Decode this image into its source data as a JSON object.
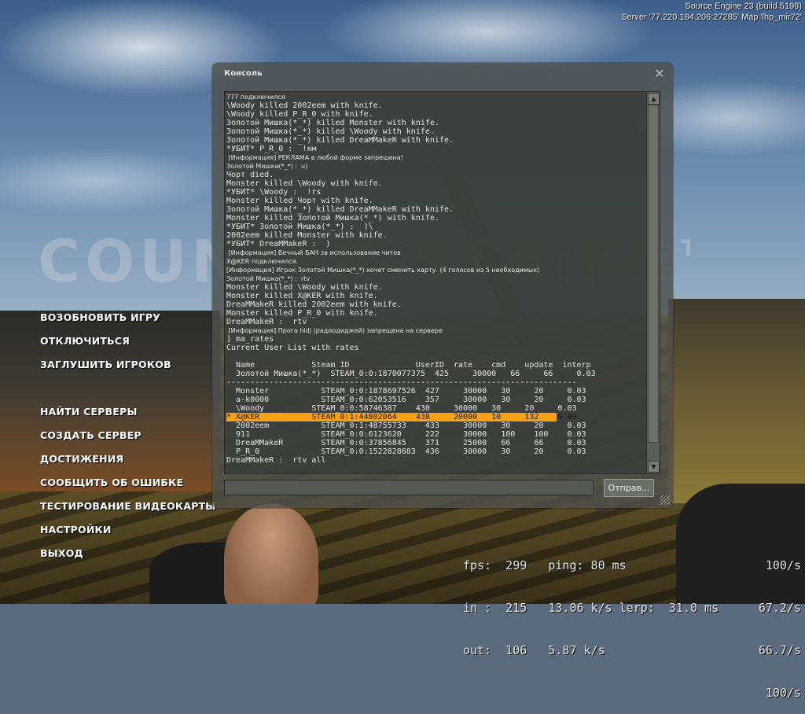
{
  "version": {
    "engine": "Source Engine 23 (build 5198)",
    "server": "Server '77.220.184.206:27285' Map 'lhp_mir72'"
  },
  "watermark": "COUNTER-STRIKE™",
  "menu": {
    "resume": "ВОЗОБНОВИТЬ ИГРУ",
    "disconnect": "ОТКЛЮЧИТЬСЯ",
    "mute": "ЗАГЛУШИТЬ ИГРОКОВ",
    "find": "НАЙТИ СЕРВЕРЫ",
    "create": "СОЗДАТЬ СЕРВЕР",
    "achievements": "ДОСТИЖЕНИЯ",
    "report": "СООБЩИТЬ ОБ ОШИБКЕ",
    "stress": "ТЕСТИРОВАНИЕ ВИДЕОКАРТЫ",
    "options": "НАСТРОЙКИ",
    "quit": "ВЫХОД"
  },
  "console": {
    "title": "Консоль",
    "close_glyph": "✕",
    "submit_label": "Отправ...",
    "input_value": "",
    "lines": [
      "777 подключился.",
      "\\Woody killed 2002eem with knife.",
      "\\Woody killed P_R_0 with knife.",
      "Золотой Мишка(*_*) killed Monster with knife.",
      "Золотой Мишка(*_*) killed \\Woody with knife.",
      "Золотой Мишка(*_*) killed DreaMMakeR with knife.",
      "*УБИТ* P_R_0 :  !км",
      " [Информация] РЕКЛАМА в любой форме запрещена!",
      "Золотой Мишка(*_*) :  u)",
      "Чорт died.",
      "Monster killed \\Woody with knife.",
      "*УБИТ* \\Woody :  !rs",
      "Monster killed Чорт with knife.",
      "Золотой Мишка(*_*) killed DreaMMakeR with knife.",
      "Monster killed Золотой Мишка(*_*) with knife.",
      "*УБИТ* Золотой Мишка(*_*) :  )\\",
      "2002eem killed Monster with knife.",
      "*УБИТ* DreaMMakeR :  )",
      " [Информация] Вечный БАН за использование читов",
      "X@KER подключился.",
      "[Информация] Игрок Золотой Мишка(*_*) хочет сменить карту. (4 голосов из 5 необходимых)",
      "Золотой Мишка(*_*) :  rtv",
      "Monster killed \\Woody with knife.",
      "Monster killed X@KER with knife.",
      "DreaMMakeR killed 2002eem with knife.",
      "Monster killed P_R_0 with knife.",
      "DreaMMakeR :  rtv",
      " [Информация] Прога hldj (радиодиджей) запрещена на сервере",
      "] ma_rates",
      "Current User List with rates",
      "",
      "  Name            Steam ID              UserID  rate    cmd    update  interp",
      "  Золотой Мишка(*_*)  STEAM_0:0:1870077375  425     30000   66     66     0.03",
      "--------------------------------------------------------------------------",
      "  Monster           STEAM_0:0:1878697526  427     30000   30     20     0.03",
      "  a-k0000           STEAM_0:0:62053516    357     30000   30     20     0.03",
      "  \\Woody          STEAM_0:0:58746387    430     30000   30     20     0.03",
      "* X@KER           STEAM_0:1:44802064    438     20000   10     132    0.00",
      "  2002eem           STEAM_0:1:48755733    433     30000   30     20     0.03",
      "  911               STEAM_0:0:6123620     222     30000   100    100    0.03",
      "  DreaMMakeR        STEAM_0:0:37856845    371     25000   66     66     0.03",
      "  P_R_0             STEAM_0:0:1522828683  436     30000   30     20     0.03",
      "DreaMMakeR :  rtv all"
    ]
  },
  "netgraph": {
    "row1_left": "fps:  299   ping: 80 ms",
    "row1_right": "100/s",
    "row2_left": "in :  215   13.06 k/s lerp:  31.0 ms",
    "row2_right": "67.2/s",
    "row3_left": "out:  106   5.87 k/s",
    "row3_right": "66.7/s",
    "row4_right": "100/s"
  },
  "colors": {
    "highlight": "#f7a116",
    "console_bg": "#4e504c",
    "menu_text": "#ffffff"
  }
}
